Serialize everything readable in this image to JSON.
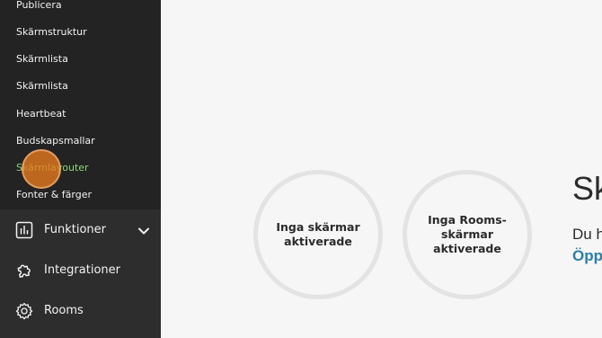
{
  "sidebar": {
    "submenu": [
      {
        "label": "Publicera"
      },
      {
        "label": "Skärmstruktur"
      },
      {
        "label": "Skärmlista"
      },
      {
        "label": "Skärmlista"
      },
      {
        "label": "Heartbeat"
      },
      {
        "label": "Budskapsmallar"
      },
      {
        "label": "Skärmlayouter",
        "active": true
      },
      {
        "label": "Fonter & färger"
      }
    ],
    "items": [
      {
        "label": "Funktioner",
        "icon": "bar-chart-icon",
        "expandable": true
      },
      {
        "label": "Integrationer",
        "icon": "puzzle-icon"
      },
      {
        "label": "Rooms",
        "icon": "gear-icon"
      }
    ]
  },
  "main": {
    "stats": [
      {
        "text": "Inga skärmar aktiverade"
      },
      {
        "text": "Inga Rooms-skärmar aktiverade"
      }
    ],
    "heading": "Sk",
    "description": "Du h",
    "link": "Öpp"
  },
  "colors": {
    "sidebar_bg": "#2d2d2d",
    "submenu_bg": "#232323",
    "active_item": "#8fd47a",
    "link": "#2a7fa8",
    "cursor_highlight": "#e87a1e",
    "page_bg": "#f7f6f6"
  }
}
